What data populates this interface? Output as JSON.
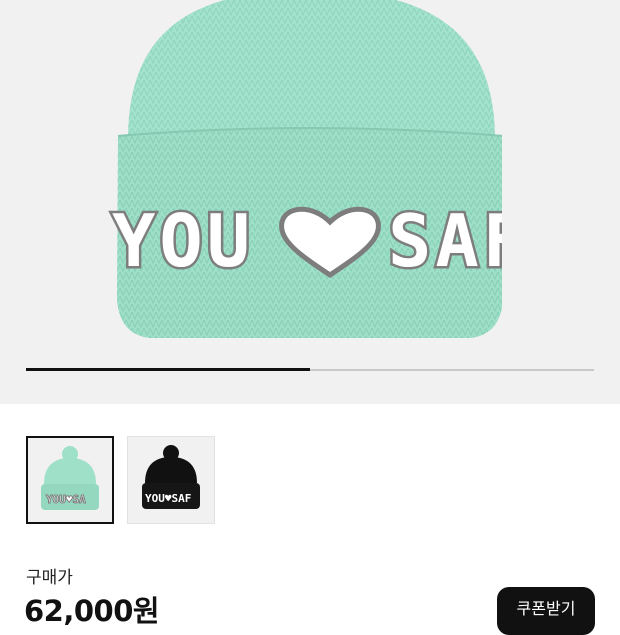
{
  "product": {
    "main_image": "mint-beanie-hat",
    "image_text": "YOU SAF",
    "carousel_progress": 0.5,
    "colors": {
      "mint": "#9fe0c9",
      "black": "#111111",
      "gray_letter": "#7d7d7d",
      "white_letter": "#ffffff"
    }
  },
  "thumbnails": [
    {
      "name": "mint-beanie",
      "selected": true
    },
    {
      "name": "black-beanie",
      "selected": false
    }
  ],
  "price": {
    "label": "구매가",
    "value": "62,000원"
  },
  "coupon_button": {
    "label": "쿠폰받기"
  }
}
